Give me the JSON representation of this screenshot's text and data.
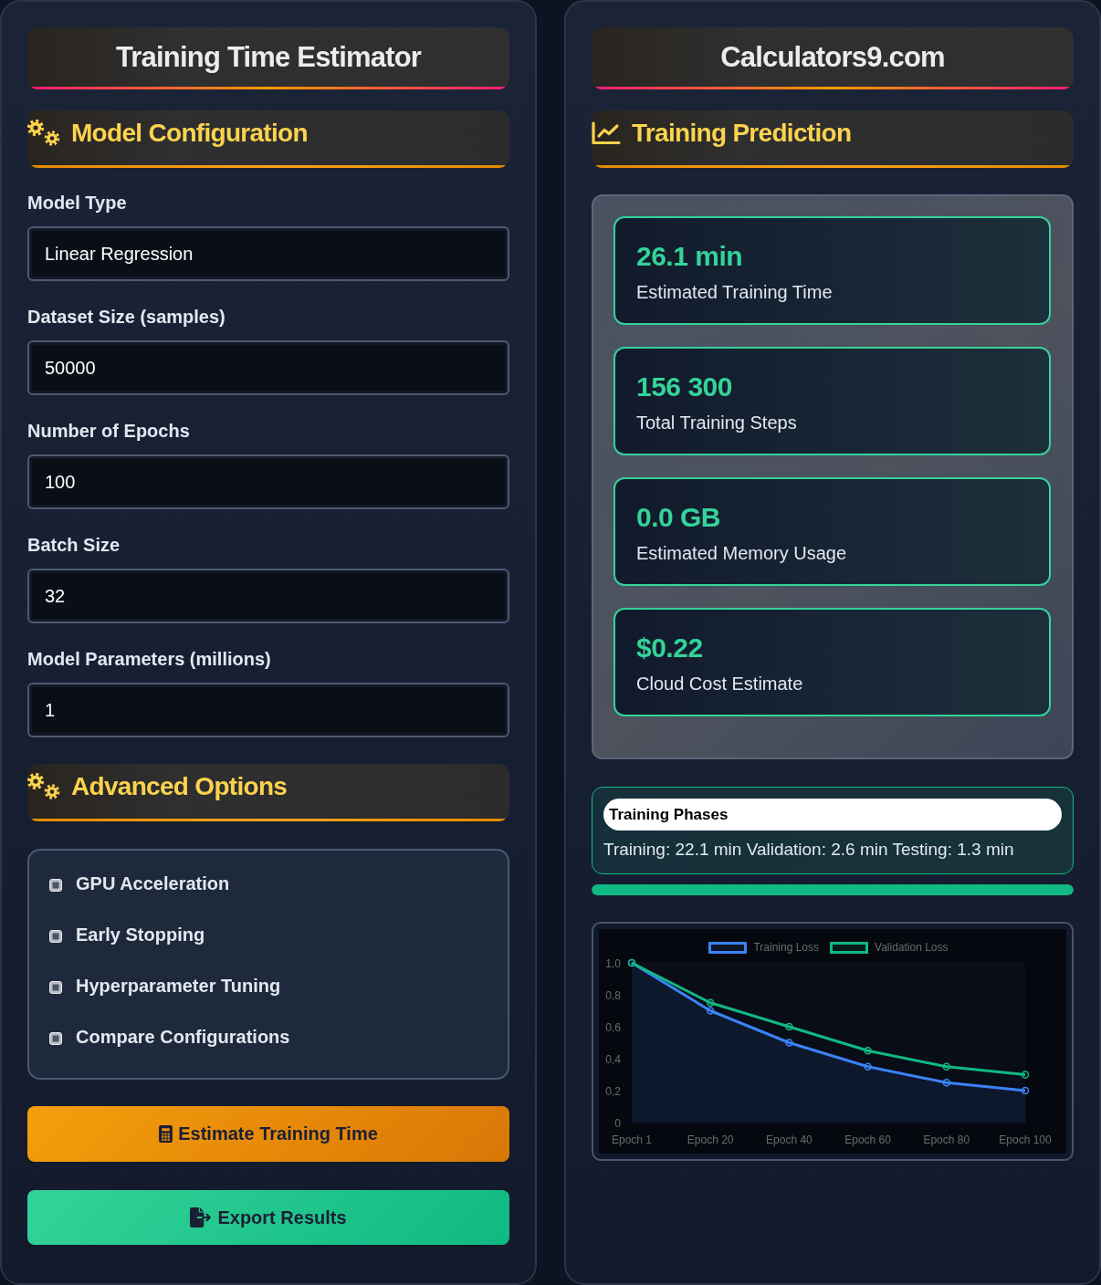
{
  "estimator": {
    "title": "Training Time Estimator",
    "model_configuration": {
      "title": "Model Configuration",
      "fields": [
        {
          "label": "Model Type",
          "value": "Linear Regression"
        },
        {
          "label": "Dataset Size (samples)",
          "value": "50000"
        },
        {
          "label": "Number of Epochs",
          "value": "100"
        },
        {
          "label": "Batch Size",
          "value": "32"
        },
        {
          "label": "Model Parameters (millions)",
          "value": "1"
        }
      ]
    },
    "advanced_options": {
      "title": "Advanced Options",
      "options": [
        {
          "label": "GPU Acceleration",
          "checked": false
        },
        {
          "label": "Early Stopping",
          "checked": false
        },
        {
          "label": "Hyperparameter Tuning",
          "checked": false
        },
        {
          "label": "Compare Configurations",
          "checked": false
        }
      ]
    },
    "buttons": [
      {
        "kind": "estimate",
        "label": "Estimate Training Time"
      },
      {
        "kind": "export",
        "label": "Export Results"
      }
    ]
  },
  "results": {
    "title": "Calculators9.com",
    "prediction": {
      "title": "Training Prediction",
      "metrics": [
        {
          "value": "26.1 min",
          "label": "Estimated Training Time"
        },
        {
          "value": "156 300",
          "label": "Total Training Steps"
        },
        {
          "value": "0.0 GB",
          "label": "Estimated Memory Usage"
        },
        {
          "value": "$0.22",
          "label": "Cloud Cost Estimate"
        }
      ]
    },
    "training_phases": {
      "title": "Training Phases",
      "summary": "Training: 22.1 min Validation: 2.6 min Testing: 1.3 min",
      "progress": {
        "level": 1
      }
    },
    "loss_chart": {
      "chart_data": {
        "type": "line",
        "legend": "top",
        "categories": [
          "Epoch 1",
          "Epoch 20",
          "Epoch 40",
          "Epoch 60",
          "Epoch 80",
          "Epoch 100"
        ],
        "series": [
          {
            "name": "Training Loss",
            "type": "area",
            "color": "#3b82f6",
            "marker": "circle",
            "values": [
              1,
              0.7,
              0.5,
              0.35,
              0.25,
              0.2
            ]
          },
          {
            "name": "Validation Loss",
            "color": "#10b981",
            "marker": "circle",
            "values": [
              1,
              0.75,
              0.6,
              0.45,
              0.35,
              0.3
            ]
          }
        ],
        "ylim": [
          0,
          1
        ],
        "yticks": [
          {
            "value": 0,
            "label": "0"
          },
          {
            "value": 0.2,
            "label": "0,2"
          },
          {
            "value": 0.4,
            "label": "0,4"
          },
          {
            "value": 0.6,
            "label": "0,6"
          },
          {
            "value": 0.8,
            "label": "0,8"
          },
          {
            "value": 1,
            "label": "1,0"
          }
        ]
      }
    }
  }
}
